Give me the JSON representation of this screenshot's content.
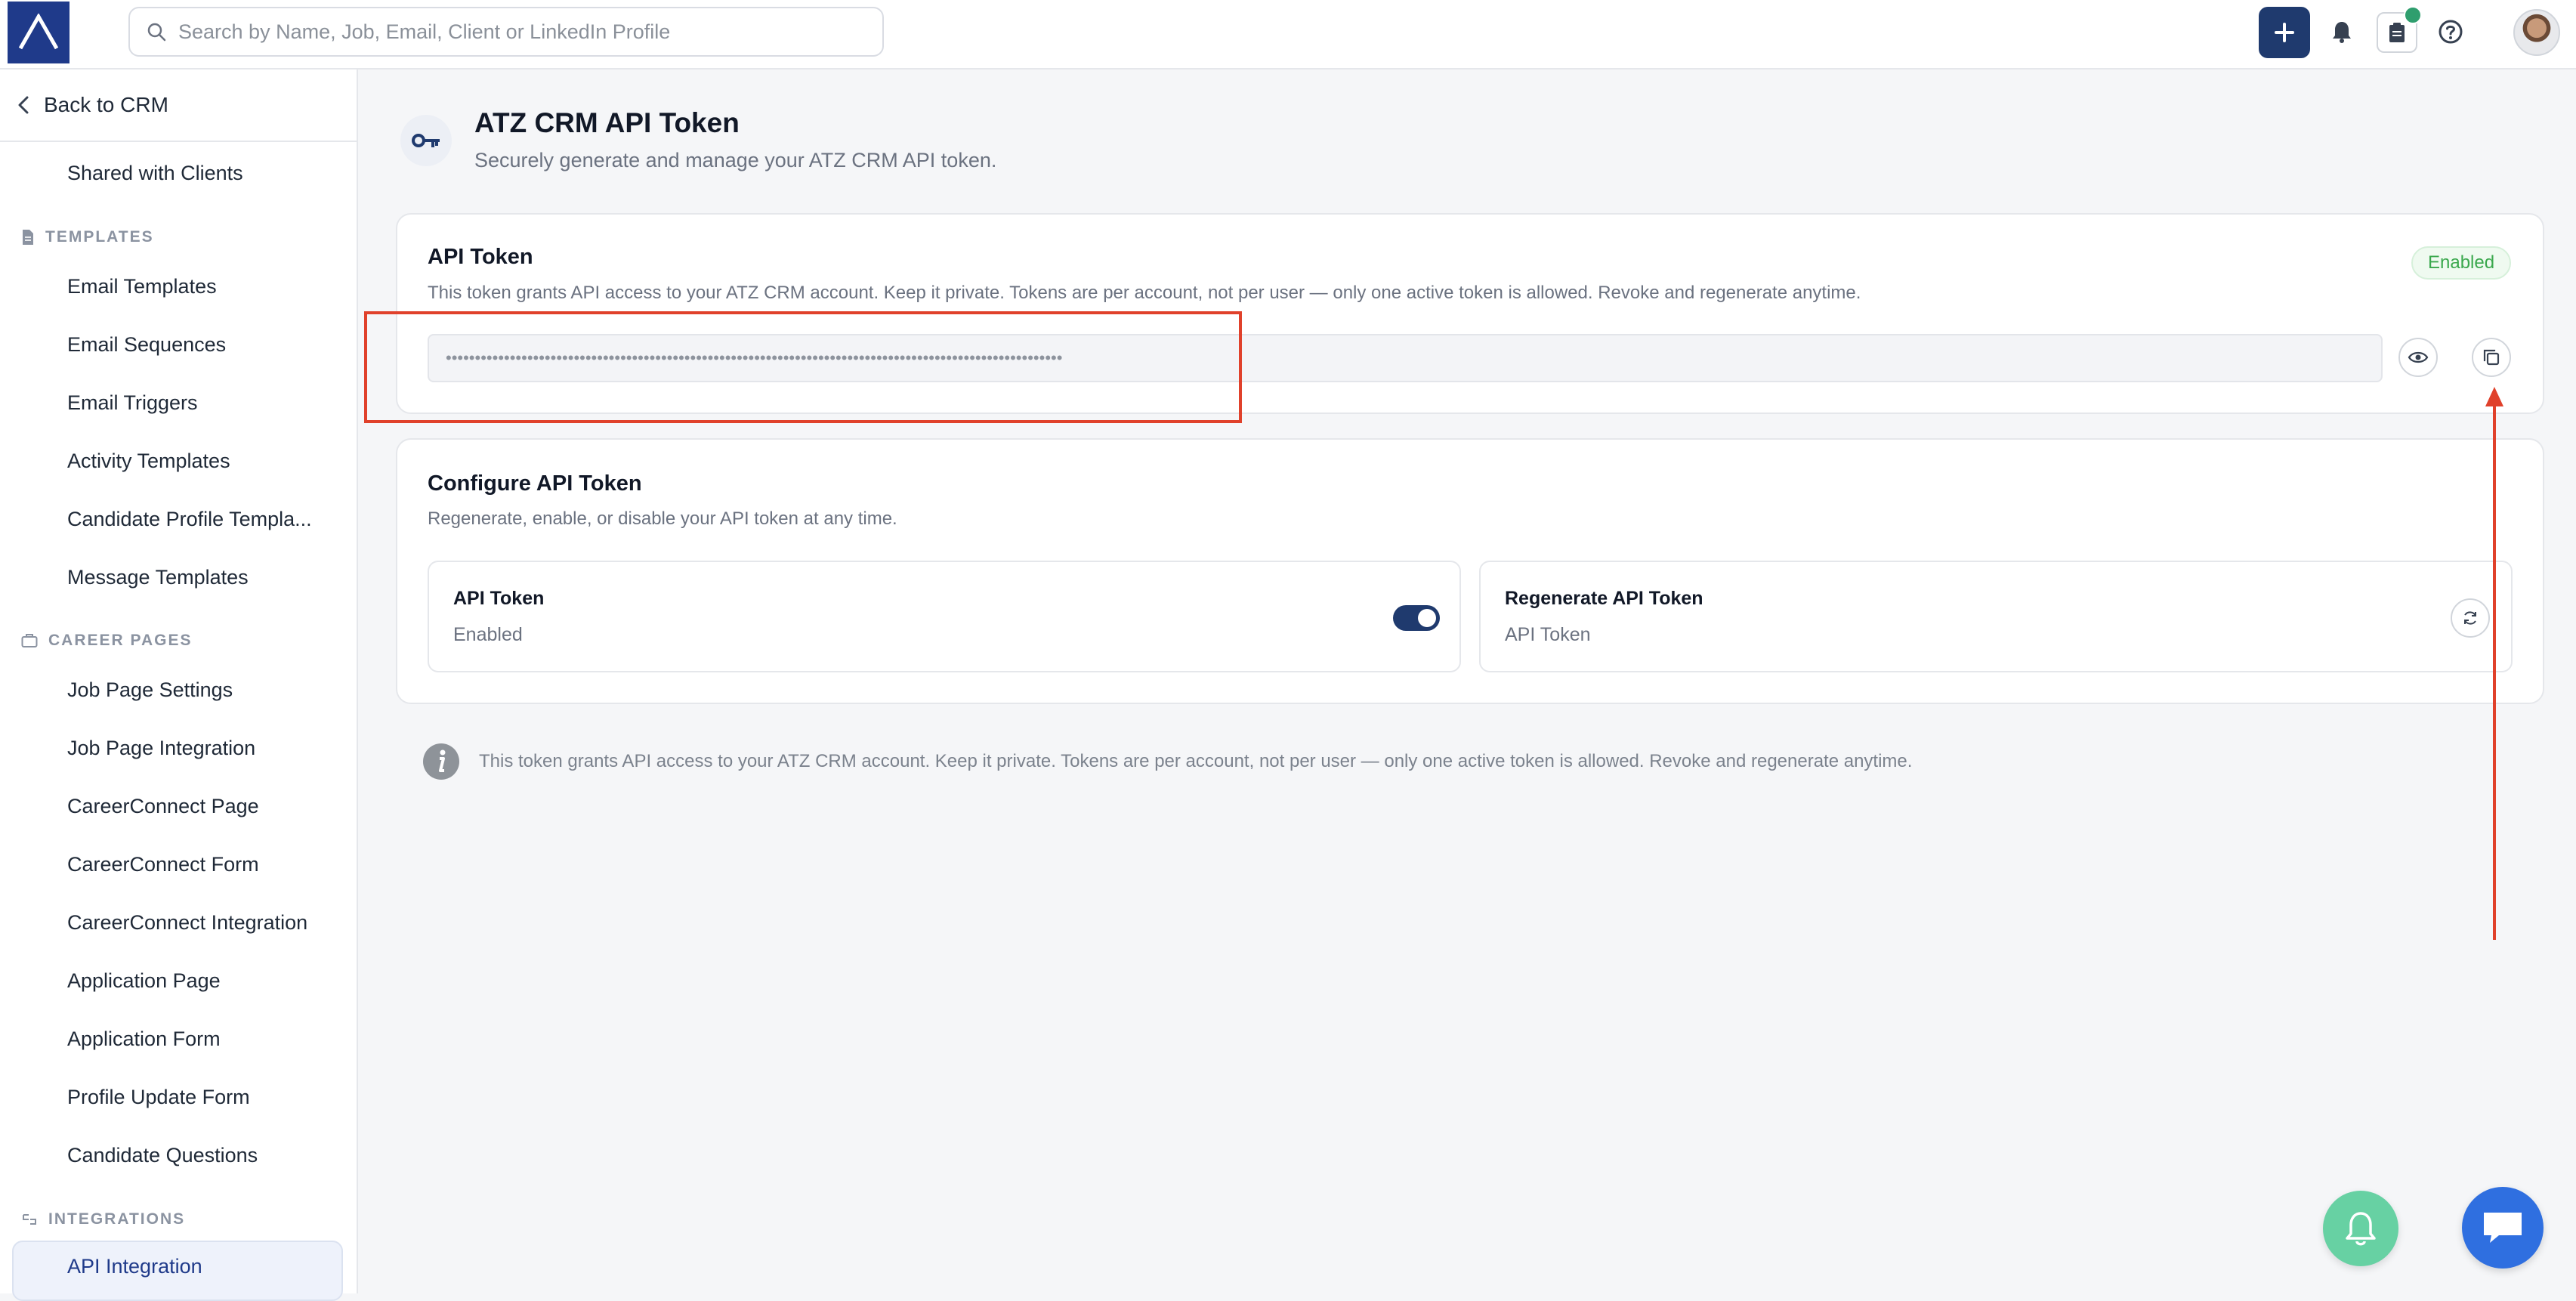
{
  "app": {
    "search_placeholder": "Search by Name, Job, Email, Client or LinkedIn Profile"
  },
  "sidebar": {
    "back_label": "Back to CRM",
    "top_item": "Shared with Clients",
    "sections": [
      {
        "title": "TEMPLATES",
        "icon": "document-icon",
        "items": [
          "Email Templates",
          "Email Sequences",
          "Email Triggers",
          "Activity Templates",
          "Candidate Profile Templa...",
          "Message Templates"
        ]
      },
      {
        "title": "CAREER PAGES",
        "icon": "briefcase-icon",
        "items": [
          "Job Page Settings",
          "Job Page Integration",
          "CareerConnect Page",
          "CareerConnect Form",
          "CareerConnect Integration",
          "Application Page",
          "Application Form",
          "Profile Update Form",
          "Candidate Questions"
        ]
      },
      {
        "title": "INTEGRATIONS",
        "icon": "integration-icon",
        "items": [
          "API Integration"
        ]
      }
    ],
    "active_item": "API Integration"
  },
  "header": {
    "title": "ATZ CRM API Token",
    "subtitle": "Securely generate and manage your ATZ CRM API token.",
    "icon": "key-icon"
  },
  "token_card": {
    "title": "API Token",
    "description": "This token grants API access to your ATZ CRM account. Keep it private. Tokens are per account, not per user — only one active token is allowed. Revoke and regenerate anytime.",
    "status_badge": "Enabled",
    "masked_token": "••••••••••••••••••••••••••••••••••••••••••••••••••••••••••••••••••••••••••••••••••••••••••••••••••••••••••"
  },
  "configure_card": {
    "title": "Configure API Token",
    "description": "Regenerate, enable, or disable your API token at any time.",
    "toggle_panel": {
      "title": "API Token",
      "value": "Enabled",
      "enabled": true
    },
    "regenerate_panel": {
      "title": "Regenerate API Token",
      "value": "API Token"
    }
  },
  "info_note": "This token grants API access to your ATZ CRM account. Keep it private. Tokens are per account, not per user — only one active token is allowed. Revoke and regenerate anytime.",
  "colors": {
    "brand": "#1f3a8a",
    "primary_button": "#1f3a6e",
    "annotation": "#e0412b",
    "badge_text": "#3aa84d",
    "bell_fab": "#67d1a3",
    "chat_fab": "#2f6fe0"
  }
}
